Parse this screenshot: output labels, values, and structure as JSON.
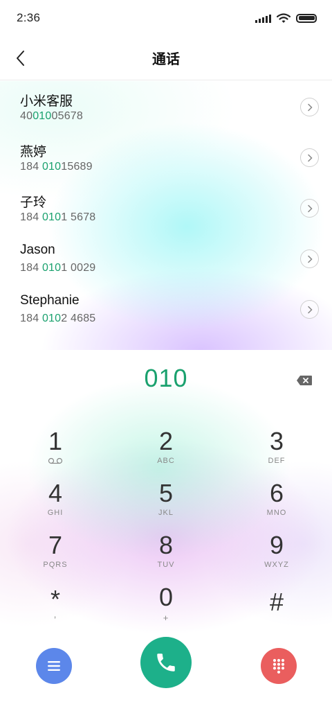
{
  "status_bar": {
    "time": "2:36",
    "icons": [
      "signal-icon",
      "wifi-icon",
      "battery-icon"
    ]
  },
  "header": {
    "title": "通话",
    "back_icon": "chevron-left-icon"
  },
  "contacts": [
    {
      "name": "小米客服",
      "number_pre": "40",
      "number_match": "010",
      "number_post": "05678"
    },
    {
      "name": "燕婷",
      "number_pre": "184 ",
      "number_match": "010",
      "number_post": "15689"
    },
    {
      "name": "子玲",
      "number_pre": "184 ",
      "number_match": "010",
      "number_post": "1 5678"
    },
    {
      "name": "Jason",
      "number_pre": "184 ",
      "number_match": "010",
      "number_post": "1 0029"
    },
    {
      "name": "Stephanie",
      "number_pre": "184 ",
      "number_match": "010",
      "number_post": "2 4685"
    }
  ],
  "dialer": {
    "dialed": "010",
    "keys": [
      {
        "digit": "1",
        "letters": ""
      },
      {
        "digit": "2",
        "letters": "ABC"
      },
      {
        "digit": "3",
        "letters": "DEF"
      },
      {
        "digit": "4",
        "letters": "GHI"
      },
      {
        "digit": "5",
        "letters": "JKL"
      },
      {
        "digit": "6",
        "letters": "MNO"
      },
      {
        "digit": "7",
        "letters": "PQRS"
      },
      {
        "digit": "8",
        "letters": "TUV"
      },
      {
        "digit": "9",
        "letters": "WXYZ"
      },
      {
        "digit": "*",
        "letters": ","
      },
      {
        "digit": "0",
        "letters": "+"
      },
      {
        "digit": "#",
        "letters": ""
      }
    ]
  },
  "actions": {
    "menu_icon": "menu-icon",
    "call_icon": "phone-icon",
    "keypad_icon": "dialpad-icon"
  },
  "colors": {
    "match_highlight": "#1aa16e",
    "call_button": "#1db08a",
    "menu_button": "#5c87ea",
    "keypad_button": "#ea5e5e"
  }
}
